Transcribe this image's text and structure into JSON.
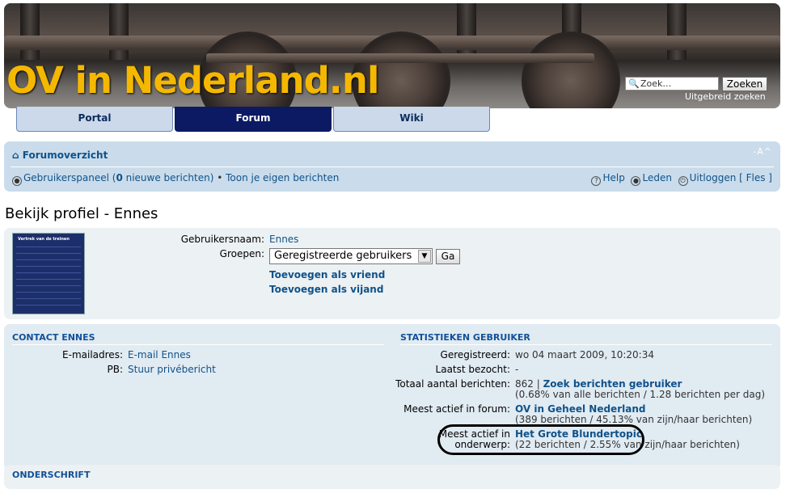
{
  "header": {
    "site_title": "OV in Nederland.nl",
    "search_placeholder": "Zoek…",
    "search_button": "Zoeken",
    "advanced_search": "Uitgebreid zoeken"
  },
  "tabs": [
    {
      "label": "Portal",
      "active": false
    },
    {
      "label": "Forum",
      "active": true
    },
    {
      "label": "Wiki",
      "active": false
    }
  ],
  "nav": {
    "forum_index": "Forumoverzicht",
    "font_resize": "-A^",
    "user_panel": "Gebruikerspaneel (",
    "new_count": "0",
    "new_messages": " nieuwe berichten)",
    "bullet": " • ",
    "own_posts": "Toon je eigen berichten",
    "help": "Help",
    "members": "Leden",
    "logout": "Uitloggen [ Fles ]"
  },
  "page_title": "Bekijk profiel - Ennes",
  "profile": {
    "username_label": "Gebruikersnaam:",
    "username": "Ennes",
    "groups_label": "Groepen:",
    "group_selected": "Geregistreerde gebruikers",
    "go_button": "Ga",
    "add_friend": "Toevoegen als vriend",
    "add_foe": "Toevoegen als vijand",
    "avatar_caption": "Vertrek van de treinen"
  },
  "contact": {
    "heading": "CONTACT ENNES",
    "email_label": "E-mailadres:",
    "email_value": "E-mail Ennes",
    "pm_label": "PB:",
    "pm_value": "Stuur privébericht"
  },
  "stats": {
    "heading": "STATISTIEKEN GEBRUIKER",
    "registered_label": "Geregistreerd:",
    "registered_value": "wo 04 maart 2009, 10:20:34",
    "last_visit_label": "Laatst bezocht:",
    "last_visit_value": "-",
    "total_posts_label": "Totaal aantal berichten:",
    "total_posts_value": "862 | ",
    "search_posts": "Zoek berichten gebruiker",
    "total_posts_sub": "(0.68% van alle berichten / 1.28 berichten per dag)",
    "active_forum_label": "Meest actief in forum:",
    "active_forum_value": "OV in Geheel Nederland",
    "active_forum_sub": "(389 berichten / 45.13% van zijn/haar berichten)",
    "active_topic_label_1": "Meest actief in",
    "active_topic_label_2": "onderwerp:",
    "active_topic_value": "Het Grote Blundertopic",
    "active_topic_sub": "(22 berichten / 2.55% van zijn/haar berichten)"
  },
  "signature": {
    "heading": "ONDERSCHRIFT"
  }
}
